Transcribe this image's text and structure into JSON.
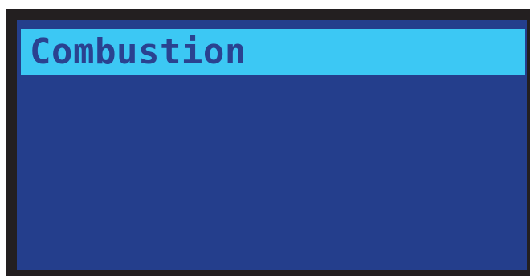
{
  "display": {
    "colors": {
      "bezel": "#231f20",
      "screen_background": "#243e8c",
      "highlight": "#3cc8f4",
      "text": "#2a4290"
    },
    "menu": {
      "items": [
        {
          "label": "Combustion",
          "selected": true
        }
      ]
    }
  }
}
